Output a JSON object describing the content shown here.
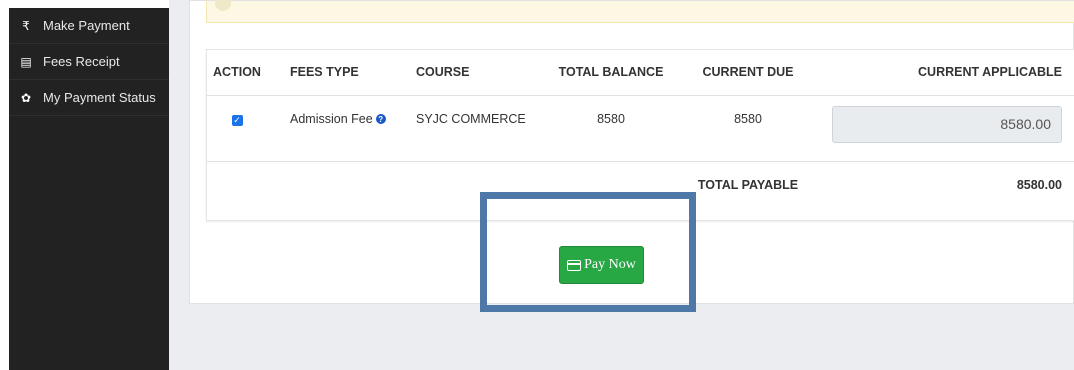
{
  "sidebar": {
    "items": [
      {
        "label": "Make Payment",
        "icon": "rupee-icon",
        "glyph": "₹"
      },
      {
        "label": "Fees Receipt",
        "icon": "receipt-icon",
        "glyph": "▤"
      },
      {
        "label": "My Payment Status",
        "icon": "gear-icon",
        "glyph": "✿"
      }
    ]
  },
  "table": {
    "headers": [
      "ACTION",
      "FEES TYPE",
      "COURSE",
      "TOTAL BALANCE",
      "CURRENT DUE",
      "CURRENT APPLICABLE"
    ],
    "row": {
      "checked": true,
      "fees_type": "Admission Fee",
      "help_glyph": "?",
      "course": "SYJC COMMERCE",
      "total_balance": "8580",
      "current_due": "8580",
      "current_applicable": "8580.00"
    },
    "total_label": "TOTAL PAYABLE",
    "total_value": "8580.00"
  },
  "actions": {
    "pay_label": "Pay Now"
  },
  "colors": {
    "sidebar_bg": "#222222",
    "pay_button": "#28a745",
    "highlight_border": "#4e78a8",
    "checkbox": "#1a73e8"
  }
}
